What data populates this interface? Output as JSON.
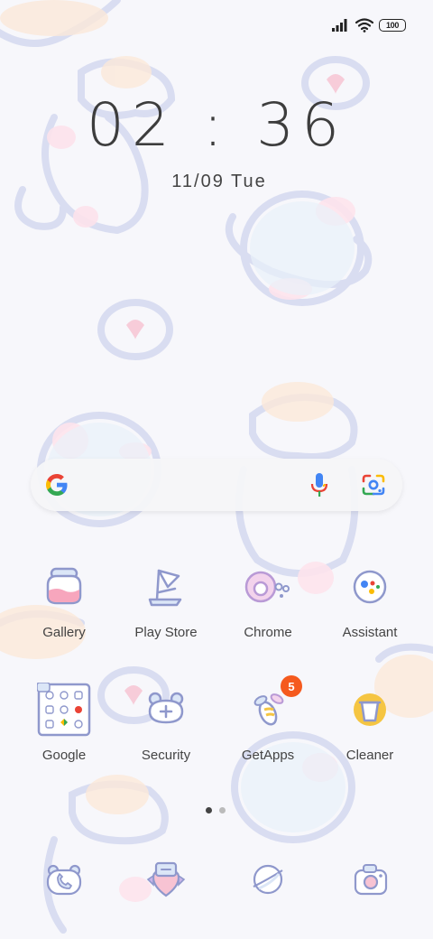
{
  "status": {
    "battery": "100",
    "icons": [
      "signal-icon",
      "wifi-icon",
      "battery-icon"
    ]
  },
  "lockscreen": {
    "time": "02 : 36",
    "date": "11/09 Tue"
  },
  "search": {
    "icons": [
      "google-logo-icon",
      "microphone-icon",
      "lens-camera-icon"
    ]
  },
  "apps": [
    {
      "label": "Gallery",
      "icon": "gallery-icon"
    },
    {
      "label": "Play Store",
      "icon": "play-store-icon"
    },
    {
      "label": "Chrome",
      "icon": "chrome-icon"
    },
    {
      "label": "Assistant",
      "icon": "assistant-icon"
    },
    {
      "label": "Google",
      "icon": "google-folder-icon"
    },
    {
      "label": "Security",
      "icon": "security-icon"
    },
    {
      "label": "GetApps",
      "icon": "getapps-icon",
      "badge": "5"
    },
    {
      "label": "Cleaner",
      "icon": "cleaner-icon"
    }
  ],
  "dock": [
    "phone-icon",
    "messages-icon",
    "browser-icon",
    "camera-icon"
  ],
  "colors": {
    "outline": "#8f98cc",
    "pink": "#f7c3d3",
    "blue": "#dcebf7",
    "badge": "#f55a1e"
  }
}
